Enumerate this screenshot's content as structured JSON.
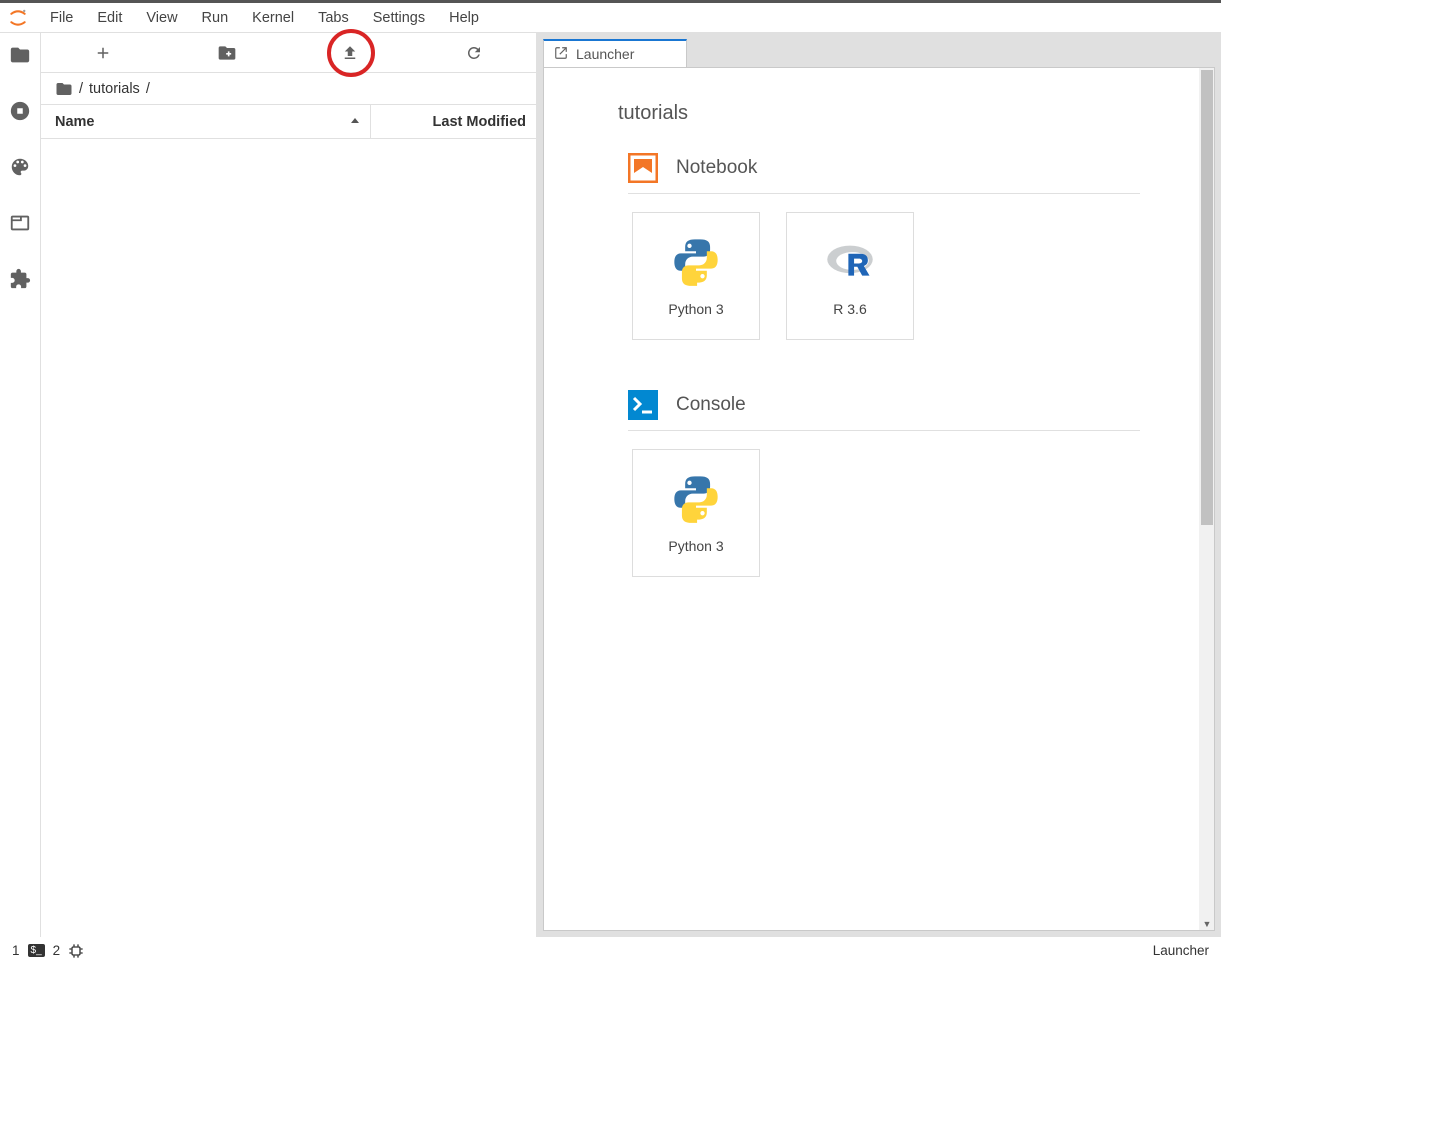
{
  "menu": {
    "items": [
      "File",
      "Edit",
      "View",
      "Run",
      "Kernel",
      "Tabs",
      "Settings",
      "Help"
    ]
  },
  "filebrowser": {
    "breadcrumb": [
      "/",
      "tutorials",
      "/"
    ],
    "columns": {
      "name": "Name",
      "modified": "Last Modified"
    }
  },
  "tab": {
    "label": "Launcher"
  },
  "launcher": {
    "title": "tutorials",
    "sections": [
      {
        "label": "Notebook",
        "cards": [
          {
            "label": "Python 3",
            "icon": "python"
          },
          {
            "label": "R 3.6",
            "icon": "r"
          }
        ]
      },
      {
        "label": "Console",
        "cards": [
          {
            "label": "Python 3",
            "icon": "python"
          }
        ]
      }
    ]
  },
  "statusbar": {
    "terminals": "1",
    "kernels": "2",
    "right": "Launcher"
  }
}
